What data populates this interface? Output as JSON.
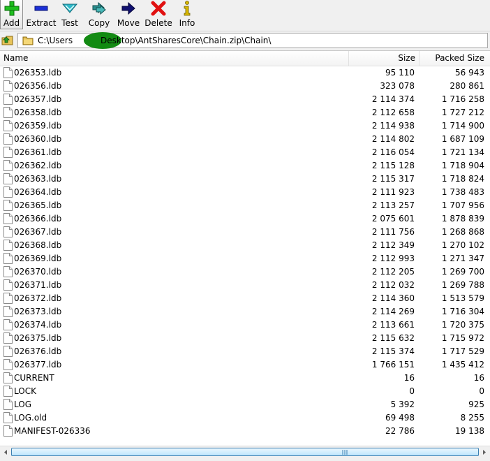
{
  "toolbar": {
    "buttons": [
      {
        "id": "add",
        "label": "Add",
        "icon": "plus-icon"
      },
      {
        "id": "extract",
        "label": "Extract",
        "icon": "minus-icon"
      },
      {
        "id": "test",
        "label": "Test",
        "icon": "check-arrow-icon"
      },
      {
        "id": "copy",
        "label": "Copy",
        "icon": "double-arrow-icon"
      },
      {
        "id": "move",
        "label": "Move",
        "icon": "arrow-right-icon"
      },
      {
        "id": "delete",
        "label": "Delete",
        "icon": "x-icon"
      },
      {
        "id": "info",
        "label": "Info",
        "icon": "info-icon"
      }
    ]
  },
  "address": {
    "path_prefix": "C:\\Users",
    "path_suffix": "Desktop\\AntSharesCore\\Chain.zip\\Chain\\"
  },
  "list": {
    "columns": {
      "name": "Name",
      "size": "Size",
      "packed": "Packed Size"
    },
    "files": [
      {
        "name": "026353.ldb",
        "size": "95 110",
        "packed": "56 943"
      },
      {
        "name": "026356.ldb",
        "size": "323 078",
        "packed": "280 861"
      },
      {
        "name": "026357.ldb",
        "size": "2 114 374",
        "packed": "1 716 258"
      },
      {
        "name": "026358.ldb",
        "size": "2 112 658",
        "packed": "1 727 212"
      },
      {
        "name": "026359.ldb",
        "size": "2 114 938",
        "packed": "1 714 900"
      },
      {
        "name": "026360.ldb",
        "size": "2 114 802",
        "packed": "1 687 109"
      },
      {
        "name": "026361.ldb",
        "size": "2 116 054",
        "packed": "1 721 134"
      },
      {
        "name": "026362.ldb",
        "size": "2 115 128",
        "packed": "1 718 904"
      },
      {
        "name": "026363.ldb",
        "size": "2 115 317",
        "packed": "1 718 824"
      },
      {
        "name": "026364.ldb",
        "size": "2 111 923",
        "packed": "1 738 483"
      },
      {
        "name": "026365.ldb",
        "size": "2 113 257",
        "packed": "1 707 956"
      },
      {
        "name": "026366.ldb",
        "size": "2 075 601",
        "packed": "1 878 839"
      },
      {
        "name": "026367.ldb",
        "size": "2 111 756",
        "packed": "1 268 868"
      },
      {
        "name": "026368.ldb",
        "size": "2 112 349",
        "packed": "1 270 102"
      },
      {
        "name": "026369.ldb",
        "size": "2 112 993",
        "packed": "1 271 347"
      },
      {
        "name": "026370.ldb",
        "size": "2 112 205",
        "packed": "1 269 700"
      },
      {
        "name": "026371.ldb",
        "size": "2 112 032",
        "packed": "1 269 788"
      },
      {
        "name": "026372.ldb",
        "size": "2 114 360",
        "packed": "1 513 579"
      },
      {
        "name": "026373.ldb",
        "size": "2 114 269",
        "packed": "1 716 304"
      },
      {
        "name": "026374.ldb",
        "size": "2 113 661",
        "packed": "1 720 375"
      },
      {
        "name": "026375.ldb",
        "size": "2 115 632",
        "packed": "1 715 972"
      },
      {
        "name": "026376.ldb",
        "size": "2 115 374",
        "packed": "1 717 529"
      },
      {
        "name": "026377.ldb",
        "size": "1 766 151",
        "packed": "1 435 412"
      },
      {
        "name": "CURRENT",
        "size": "16",
        "packed": "16"
      },
      {
        "name": "LOCK",
        "size": "0",
        "packed": "0"
      },
      {
        "name": "LOG",
        "size": "5 392",
        "packed": "925"
      },
      {
        "name": "LOG.old",
        "size": "69 498",
        "packed": "8 255"
      },
      {
        "name": "MANIFEST-026336",
        "size": "22 786",
        "packed": "19 138"
      }
    ]
  },
  "colors": {
    "add": "#1fbf1f",
    "extract": "#1b2fd6",
    "test": "#2fb8c8",
    "copy": "#2a8f8f",
    "move": "#101070",
    "delete": "#e01010",
    "info": "#d8b800",
    "scroll_thumb": "#bee6fd"
  }
}
